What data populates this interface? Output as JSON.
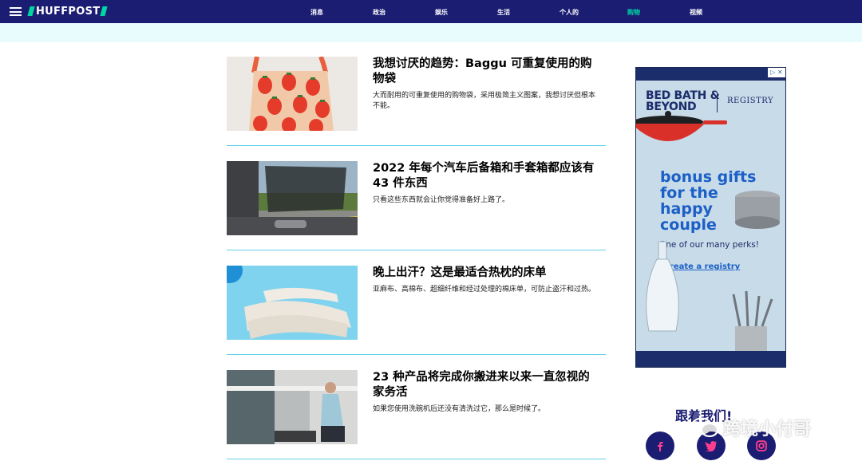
{
  "header": {
    "logo": "HUFFPOST",
    "nav": [
      "消息",
      "政治",
      "娱乐",
      "生活",
      "个人的",
      "购物",
      "视频"
    ],
    "active_index": 5,
    "accent_color": "#00d6a4",
    "bar_color": "#1b1d73"
  },
  "articles": [
    {
      "title": "我想讨厌的趋势：Baggu 可重复使用的购物袋",
      "desc": "大而耐用的可重复使用的购物袋，采用极简主义图案，我想讨厌但根本不能。",
      "image": "strawberry-tote-bag"
    },
    {
      "title": "2022 年每个汽车后备箱和手套箱都应该有 43 件东西",
      "desc": "只看这些东西就会让你觉得准备好上路了。",
      "image": "car-window-shade"
    },
    {
      "title": "晚上出汗？这是最适合热枕的床单",
      "desc": "亚麻布、高棉布、超细纤维和经过处理的棉床单，可防止盗汗和过热。",
      "image": "folded-bed-sheets"
    },
    {
      "title": "23 种产品将完成你搬进来以来一直忽视的家务活",
      "desc": "如果您使用洗碗机后还没有清洗过它，那么是时候了。",
      "image": "dishwasher-kitchen"
    }
  ],
  "ad": {
    "brand_line1": "BED BATH &",
    "brand_line2": "BEYOND",
    "registry": "REGISTRY",
    "headline_lines": [
      "bonus gifts",
      "for the",
      "happy",
      "couple"
    ],
    "perks": "One of our many perks!",
    "cta": "create a registry",
    "adchoices": "▷ ✕"
  },
  "follow": {
    "label": "跟着我们!",
    "networks": [
      "facebook",
      "twitter",
      "instagram"
    ]
  },
  "watermark": "跨境小付哥"
}
